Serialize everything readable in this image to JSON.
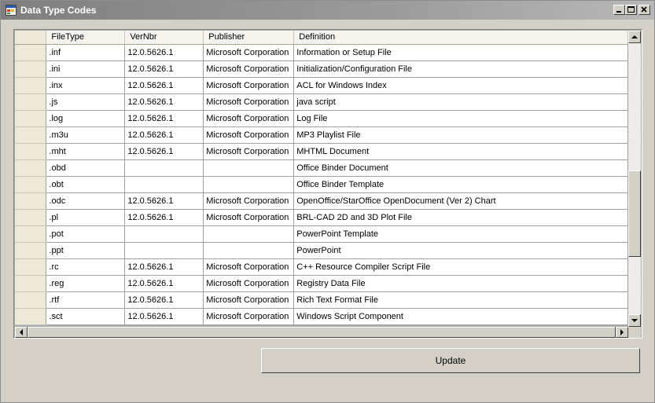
{
  "window": {
    "title": "Data Type Codes",
    "icon": "app-window-icon",
    "buttons": {
      "minimize": "minimize-icon",
      "maximize": "maximize-icon",
      "close": "close-icon"
    }
  },
  "grid": {
    "columns": [
      "FileType",
      "VerNbr",
      "Publisher",
      "Definition"
    ],
    "rows": [
      [
        ".inf",
        "12.0.5626.1",
        "Microsoft Corporation",
        "Information or Setup File"
      ],
      [
        ".ini",
        "12.0.5626.1",
        "Microsoft Corporation",
        "Initialization/Configuration File"
      ],
      [
        ".inx",
        "12.0.5626.1",
        "Microsoft Corporation",
        "ACL for Windows Index"
      ],
      [
        ".js",
        "12.0.5626.1",
        "Microsoft Corporation",
        "java script"
      ],
      [
        ".log",
        "12.0.5626.1",
        "Microsoft Corporation",
        "Log File"
      ],
      [
        ".m3u",
        "12.0.5626.1",
        "Microsoft Corporation",
        "MP3 Playlist File"
      ],
      [
        ".mht",
        "12.0.5626.1",
        "Microsoft Corporation",
        "MHTML Document"
      ],
      [
        ".obd",
        "",
        "",
        "Office Binder Document"
      ],
      [
        ".obt",
        "",
        "",
        "Office Binder Template"
      ],
      [
        ".odc",
        "12.0.5626.1",
        "Microsoft Corporation",
        "OpenOffice/StarOffice OpenDocument (Ver 2) Chart"
      ],
      [
        ".pl",
        "12.0.5626.1",
        "Microsoft Corporation",
        "BRL-CAD 2D and 3D Plot File"
      ],
      [
        ".pot",
        "",
        "",
        "PowerPoint Template"
      ],
      [
        ".ppt",
        "",
        "",
        "PowerPoint"
      ],
      [
        ".rc",
        "12.0.5626.1",
        "Microsoft Corporation",
        "C++ Resource Compiler Script File"
      ],
      [
        ".reg",
        "12.0.5626.1",
        "Microsoft Corporation",
        "Registry Data File"
      ],
      [
        ".rtf",
        "12.0.5626.1",
        "Microsoft Corporation",
        "Rich Text Format File"
      ],
      [
        ".sct",
        "12.0.5626.1",
        "Microsoft Corporation",
        "Windows Script Component"
      ]
    ]
  },
  "update_label": "Update"
}
